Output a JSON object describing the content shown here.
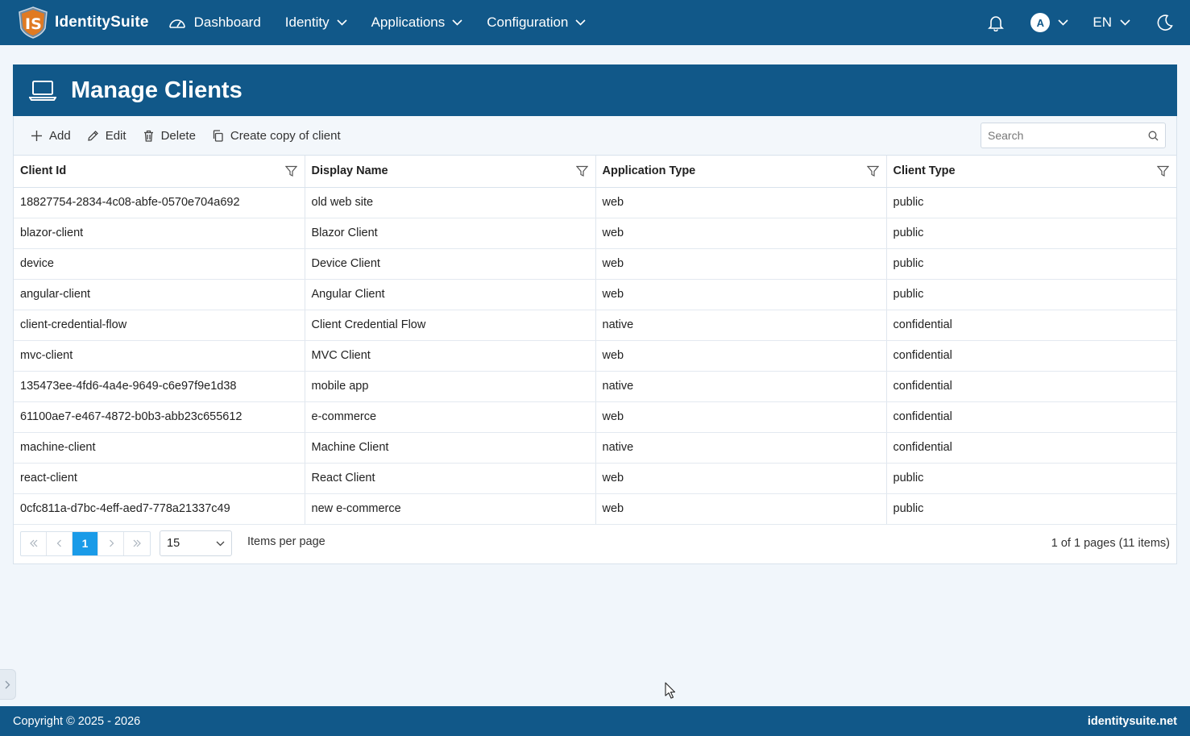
{
  "nav": {
    "brand": "IdentitySuite",
    "dashboard": "Dashboard",
    "menus": [
      "Identity",
      "Applications",
      "Configuration"
    ],
    "avatar_initial": "A",
    "language": "EN"
  },
  "page": {
    "title": "Manage Clients"
  },
  "toolbar": {
    "add_label": "Add",
    "edit_label": "Edit",
    "delete_label": "Delete",
    "copy_label": "Create copy of client",
    "search_placeholder": "Search"
  },
  "table": {
    "columns": [
      "Client Id",
      "Display Name",
      "Application Type",
      "Client Type"
    ],
    "rows": [
      [
        "18827754-2834-4c08-abfe-0570e704a692",
        "old web site",
        "web",
        "public"
      ],
      [
        "blazor-client",
        "Blazor Client",
        "web",
        "public"
      ],
      [
        "device",
        "Device Client",
        "web",
        "public"
      ],
      [
        "angular-client",
        "Angular Client",
        "web",
        "public"
      ],
      [
        "client-credential-flow",
        "Client Credential Flow",
        "native",
        "confidential"
      ],
      [
        "mvc-client",
        "MVC Client",
        "web",
        "confidential"
      ],
      [
        "135473ee-4fd6-4a4e-9649-c6e97f9e1d38",
        "mobile app",
        "native",
        "confidential"
      ],
      [
        "61100ae7-e467-4872-b0b3-abb23c655612",
        "e-commerce",
        "web",
        "confidential"
      ],
      [
        "machine-client",
        "Machine Client",
        "native",
        "confidential"
      ],
      [
        "react-client",
        "React Client",
        "web",
        "public"
      ],
      [
        "0cfc811a-d7bc-4eff-aed7-778a21337c49",
        "new e-commerce",
        "web",
        "public"
      ]
    ]
  },
  "pager": {
    "current_page": "1",
    "page_size": "15",
    "items_per_page_label": "Items per page",
    "info": "1 of 1 pages (11 items)"
  },
  "footer": {
    "copyright": "Copyright © 2025 - 2026",
    "site": "identitysuite.net"
  },
  "colors": {
    "primary": "#115889",
    "accent": "#1a9be8",
    "background": "#f1f6fb"
  }
}
